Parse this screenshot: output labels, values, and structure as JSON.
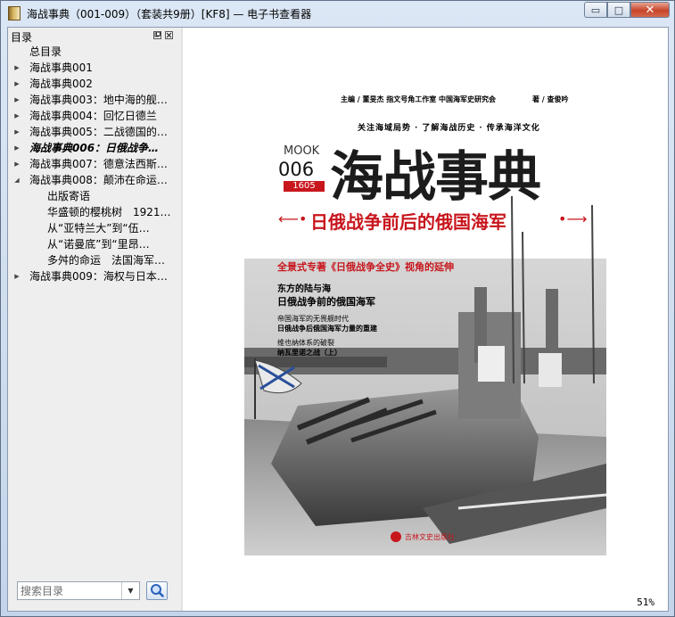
{
  "window": {
    "title": "海战事典（001-009）（套装共9册）[KF8] — 电子书查看器",
    "minimize_glyph": "▭",
    "maximize_glyph": "□",
    "close_glyph": "✕"
  },
  "sidebar": {
    "title": "目录",
    "items": [
      {
        "label": "总目录",
        "level": 0,
        "expander": "none"
      },
      {
        "label": "海战事典001",
        "level": 0,
        "expander": "collapsed"
      },
      {
        "label": "海战事典002",
        "level": 0,
        "expander": "collapsed"
      },
      {
        "label": "海战事典003：地中海的舰…",
        "level": 0,
        "expander": "collapsed"
      },
      {
        "label": "海战事典004：回忆日德兰",
        "level": 0,
        "expander": "collapsed"
      },
      {
        "label": "海战事典005：二战德国的…",
        "level": 0,
        "expander": "collapsed"
      },
      {
        "label": "海战事典006：日俄战争…",
        "level": 0,
        "expander": "collapsed",
        "current": true
      },
      {
        "label": "海战事典007：德意法西斯…",
        "level": 0,
        "expander": "collapsed"
      },
      {
        "label": "海战事典008：颠沛在命运…",
        "level": 0,
        "expander": "expanded"
      },
      {
        "label": "出版寄语",
        "level": 1,
        "expander": "none"
      },
      {
        "label": "华盛顿的樱桃树　1921…",
        "level": 1,
        "expander": "none"
      },
      {
        "label": "从“亚特兰大”到“伍…",
        "level": 1,
        "expander": "none"
      },
      {
        "label": "从“诺曼底”到“里昂…",
        "level": 1,
        "expander": "none"
      },
      {
        "label": "多舛的命运　法国海军…",
        "level": 1,
        "expander": "none"
      },
      {
        "label": "海战事典009：海权与日本…",
        "level": 0,
        "expander": "collapsed"
      }
    ],
    "search": {
      "placeholder": "搜索目录"
    }
  },
  "cover": {
    "editors_line": "主编 / 董旻杰  指文号角工作室  中国海军史研究会",
    "author_line": "著 / 查俊吟",
    "tagline": "关注海域局势 · 了解海战历史 · 传承海洋文化",
    "mook": "MOOK",
    "issue_no": "006",
    "issue_code": "1605",
    "title": "海战事典",
    "subtitle": "日俄战争前后的俄国海军",
    "highlight": "全景式专著《日俄战争全史》视角的延伸",
    "topic1_a": "东方的陆与海",
    "topic1_b": "日俄战争前的俄国海军",
    "topic2_a": "帝国海军的无畏舰时代",
    "topic2_b": "日俄战争后俄国海军力量的重建",
    "topic3_a": "维也纳体系的破裂",
    "topic3_b": "纳瓦里诺之战（上）",
    "publisher": "吉林文史出版社"
  },
  "status": {
    "zoom": "51%"
  },
  "colors": {
    "accent_red": "#c8161d",
    "cover_dark": "#222222"
  }
}
